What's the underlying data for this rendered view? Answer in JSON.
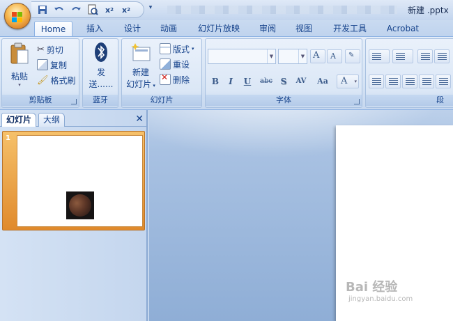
{
  "window": {
    "title": "新建 .pptx"
  },
  "quick_access": {
    "more": "▾"
  },
  "tabs": [
    {
      "label": "Home",
      "active": true
    },
    {
      "label": "插入"
    },
    {
      "label": "设计"
    },
    {
      "label": "动画"
    },
    {
      "label": "幻灯片放映"
    },
    {
      "label": "审阅"
    },
    {
      "label": "视图"
    },
    {
      "label": "开发工具"
    },
    {
      "label": "Acrobat"
    }
  ],
  "ribbon": {
    "clipboard": {
      "group": "剪贴板",
      "paste": "粘贴",
      "cut": "剪切",
      "copy": "复制",
      "format_painter": "格式刷"
    },
    "bluetooth": {
      "group": "蓝牙",
      "send_line1": "发",
      "send_line2": "送......"
    },
    "slides": {
      "group": "幻灯片",
      "new_line1": "新建",
      "new_line2": "幻灯片",
      "layout": "版式",
      "reset": "重设",
      "delete": "删除"
    },
    "font": {
      "group": "字体",
      "bold": "B",
      "italic": "I",
      "underline": "U",
      "strike": "abc",
      "shadow": "S",
      "spacing": "AV",
      "case": "Aa",
      "color": "A",
      "grow": "A",
      "shrink": "A"
    },
    "paragraph": {
      "group_partial": "段"
    }
  },
  "panel": {
    "tab_slides": "幻灯片",
    "tab_outline": "大纲",
    "close": "✕",
    "slide_number": "1"
  },
  "watermark": {
    "line1": "Bai 经验",
    "line2": "jingyan.baidu.com"
  }
}
